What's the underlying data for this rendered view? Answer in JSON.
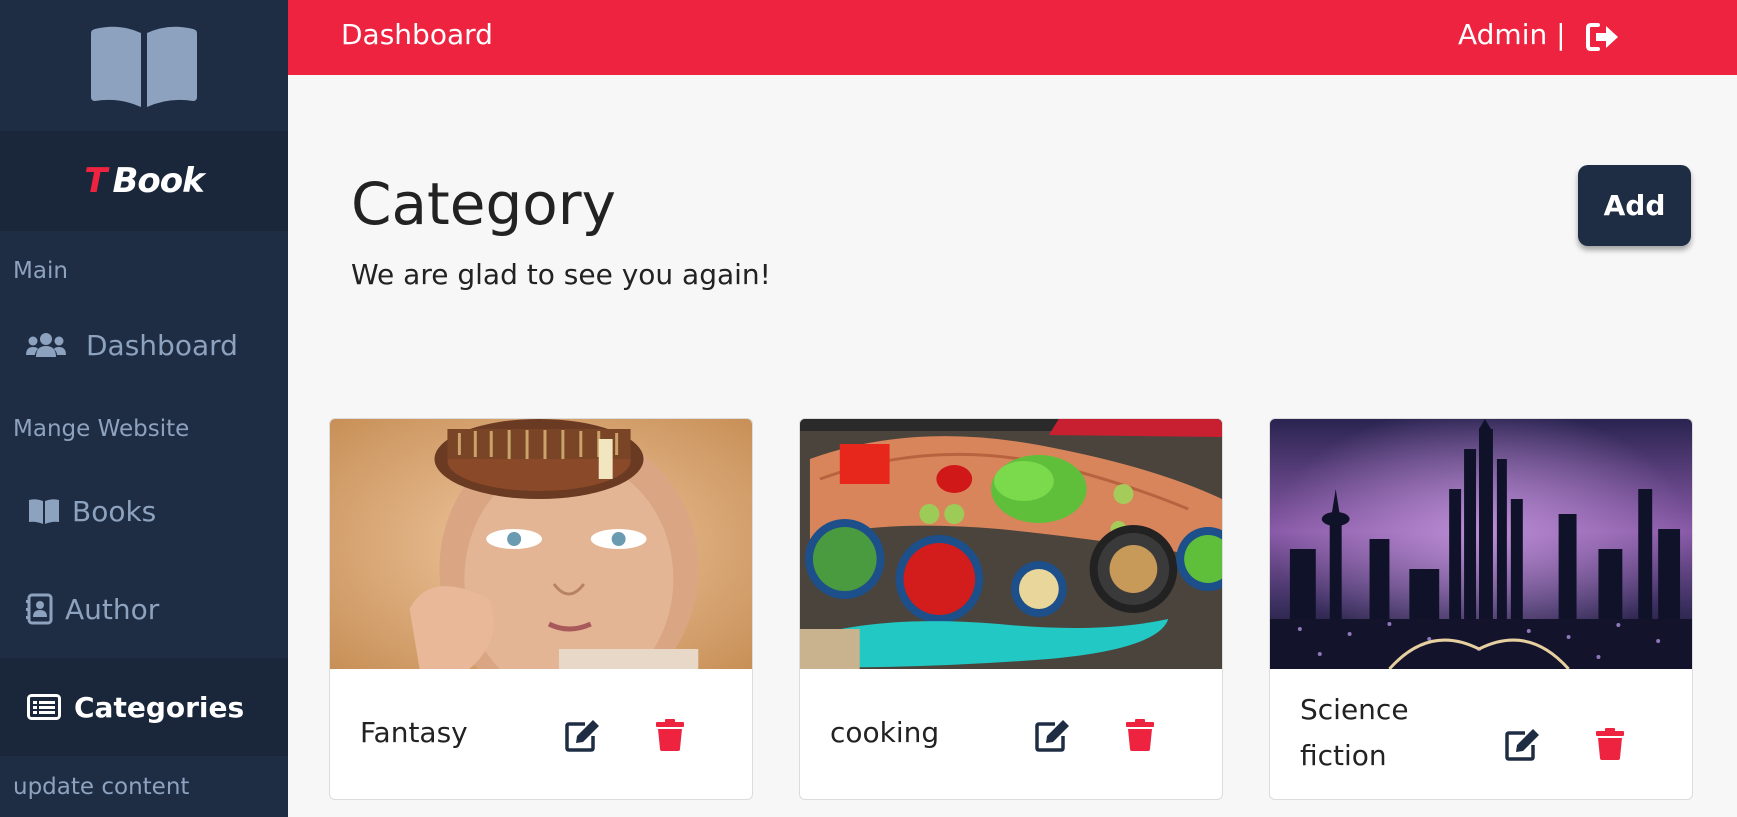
{
  "colors": {
    "sidebar_bg": "#1f2d44",
    "sidebar_active_bg": "#1a263a",
    "accent": "#ee2340",
    "sidebar_text": "#8da2be"
  },
  "brand": {
    "prefix": "T",
    "name": "Book"
  },
  "sidebar": {
    "sections": [
      {
        "label": "Main",
        "items": [
          {
            "label": "Dashboard",
            "icon": "users-icon"
          }
        ]
      },
      {
        "label": "Mange Website",
        "items": [
          {
            "label": "Books",
            "icon": "book-icon"
          },
          {
            "label": "Author",
            "icon": "address-book-icon"
          },
          {
            "label": "Categories",
            "icon": "list-icon",
            "active": true
          }
        ]
      },
      {
        "label": "update content",
        "items": []
      }
    ]
  },
  "topbar": {
    "title": "Dashboard",
    "user": "Admin |",
    "logout_icon": "sign-out-icon"
  },
  "page": {
    "title": "Category",
    "subtitle": "We are glad to see you again!",
    "add_label": "Add"
  },
  "categories": [
    {
      "name": "Fantasy",
      "image": "woman-library-head",
      "edit_icon": "edit-icon",
      "delete_icon": "trash-icon"
    },
    {
      "name": "cooking",
      "image": "vegetables-table",
      "edit_icon": "edit-icon",
      "delete_icon": "trash-icon"
    },
    {
      "name": "Science fiction",
      "image": "futuristic-city",
      "edit_icon": "edit-icon",
      "delete_icon": "trash-icon"
    }
  ]
}
